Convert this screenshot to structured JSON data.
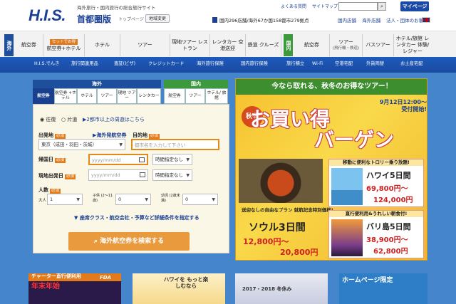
{
  "header": {
    "logo": "H.I.S.",
    "tagline": "海外旅行・国内旅行の総合旅行サイト",
    "branch": "首都圏版",
    "toppage": "トップページ",
    "region_button": "地域変更",
    "stats": "国内296店舗/海外67か国158都市279拠点",
    "links": [
      "よくある質問",
      "サイトマップ"
    ],
    "search_placeholder": "",
    "mypage": "マイページ",
    "tabs": [
      "国内店舗",
      "海外店舗",
      "法人・団体のお客様"
    ]
  },
  "gnav": {
    "overseas_label": "海外",
    "domestic_label": "国内",
    "overseas_items": [
      {
        "label": "航空券"
      },
      {
        "badge": "セットでお得",
        "label": "航空券+ホテル"
      },
      {
        "label": "ホテル"
      },
      {
        "label": "ツアー"
      },
      {
        "label": "現地ツアー レストラン"
      },
      {
        "label": "レンタカー 空港送迎"
      },
      {
        "label": "鉄道 クルーズ"
      }
    ],
    "domestic_items": [
      {
        "label": "航空券"
      },
      {
        "label": "ツアー",
        "sub": "(飛行機・鉄道)"
      },
      {
        "label": "バスツアー"
      },
      {
        "label": "ホテル/旅館 レンタカー 体験/レジャー"
      }
    ]
  },
  "services": [
    "H.I.S.でんき",
    "旅行関連用品",
    "査証(ビザ)",
    "クレジットカード",
    "海外旅行保険",
    "国内旅行保険",
    "旅行積立",
    "Wi-Fi",
    "空港宅配",
    "外貨両替",
    "お土産宅配"
  ],
  "search": {
    "tab_overseas": "海外",
    "tab_domestic": "国内",
    "overseas_tabs": [
      "航空券",
      "航空券 +ホテル",
      "ホテル",
      "ツアー",
      "現地 ツアー",
      "レンタカー"
    ],
    "domestic_tabs": [
      "航空券",
      "ツアー",
      "ホテル/ 旅館"
    ],
    "trip_type": {
      "roundtrip": "往復",
      "oneway": "片道",
      "multi_link": "2都市以上の周遊はこちら"
    },
    "required": "必須",
    "departure": {
      "label": "出発地",
      "value": "東京（成田・羽田・茨城）"
    },
    "airport_search": "海外発航空券",
    "destination": {
      "label": "目的地",
      "placeholder": "都市名を入力して下さい"
    },
    "return_date": {
      "label": "帰国日",
      "placeholder": "yyyy/mm/dd",
      "time": "時間指定なし"
    },
    "depart_date": {
      "label": "現地出発日",
      "placeholder": "yyyy/mm/dd",
      "time": "時間指定なし"
    },
    "pax": {
      "label": "人数",
      "adult_label": "大人",
      "adult": "1",
      "child_label": "子供 (2〜11歳)",
      "child": "0",
      "infant_label": "幼児 (2歳未満)",
      "infant": "0"
    },
    "detail_link": "座席クラス・航空会社・予算など詳細条件を指定する",
    "cta": "海外航空券を検索する"
  },
  "banner": {
    "top": "今なら取れる、秋冬のお得なツアー！",
    "autumn": "秋冬",
    "main1": "お買い得",
    "main2": "バーゲン",
    "date": "9月12日12:00〜 受付開始!",
    "seoul_note": "送迎なしの自由なプラン 就航記念特別価格!",
    "seoul": "ソウル3日間",
    "seoul_price1": "12,800円〜",
    "seoul_price2": "20,800円",
    "hawaii_head": "移動に便利なトロリー乗り放題!",
    "hawaii": "ハワイ5日間",
    "hawaii_price1": "69,800円〜",
    "hawaii_price2": "124,000円",
    "bali_head": "直行便利用&うれしい朝食付!",
    "bali": "バリ島5日間",
    "bali_price1": "38,900円〜",
    "bali_price2": "62,800円"
  },
  "promos": [
    {
      "title": "チャーター直行便利用",
      "sub": "年末年始",
      "brand": "FDA"
    },
    {
      "title": "ハワイを もっと楽しむなら",
      "sub": ""
    },
    {
      "title": "2017・2018 冬休み",
      "sub": ""
    },
    {
      "title": "ホームページ限定",
      "sub": ""
    }
  ]
}
